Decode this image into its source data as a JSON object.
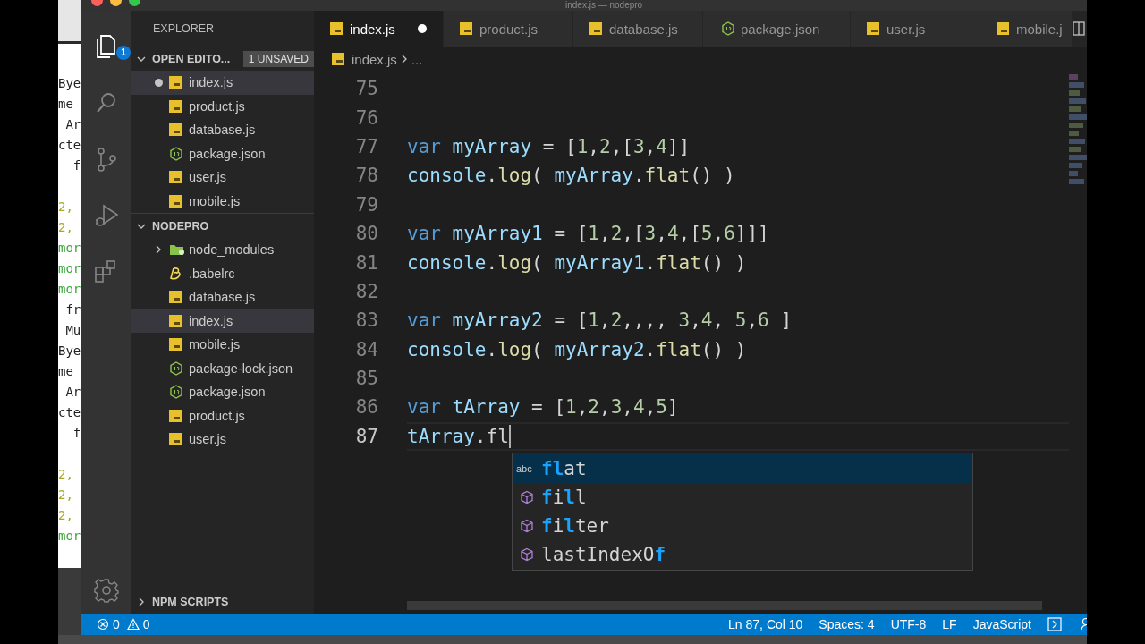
{
  "window": {
    "title": "index.js — nodepro"
  },
  "background_terminal": {
    "lines": [
      {
        "text": "Bye",
        "kind": "plain"
      },
      {
        "text": "me",
        "kind": "plain"
      },
      {
        "text": " Ar",
        "kind": "plain"
      },
      {
        "text": "cte",
        "kind": "plain"
      },
      {
        "text": "  f",
        "kind": "plain"
      },
      {
        "kind": "blank"
      },
      {
        "text": "2,",
        "kind": "number"
      },
      {
        "text": "2,",
        "kind": "number"
      },
      {
        "text": "mor",
        "kind": "string"
      },
      {
        "text": "mor",
        "kind": "string"
      },
      {
        "text": "mor",
        "kind": "string"
      },
      {
        "text": " fr",
        "kind": "plain"
      },
      {
        "text": " Mu",
        "kind": "plain"
      },
      {
        "text": "Bye",
        "kind": "plain"
      },
      {
        "text": "me",
        "kind": "plain"
      },
      {
        "text": " Ar",
        "kind": "plain"
      },
      {
        "text": "cte",
        "kind": "plain"
      },
      {
        "text": "  f",
        "kind": "plain"
      },
      {
        "kind": "blank"
      },
      {
        "text": "2,",
        "kind": "number"
      },
      {
        "text": "2,",
        "kind": "number"
      },
      {
        "text": "2,",
        "kind": "number"
      },
      {
        "text": "mor",
        "kind": "string"
      }
    ]
  },
  "activity_bar": {
    "items": [
      {
        "kind": "explorer",
        "selected": true,
        "badge": "1"
      },
      {
        "kind": "search",
        "selected": false
      },
      {
        "kind": "source-control",
        "selected": false
      },
      {
        "kind": "debug",
        "selected": false
      },
      {
        "kind": "extensions",
        "selected": false
      }
    ],
    "bottom": [
      {
        "kind": "settings"
      }
    ]
  },
  "sidebar": {
    "title": "EXPLORER",
    "sections": [
      {
        "title": "OPEN EDITO...",
        "expanded": true,
        "badge": "1 UNSAVED",
        "items": [
          {
            "label": "index.js",
            "kind": "js",
            "dirty": true,
            "selected": true
          },
          {
            "label": "product.js",
            "kind": "js",
            "dirty": false,
            "selected": false
          },
          {
            "label": "database.js",
            "kind": "js",
            "dirty": false,
            "selected": false
          },
          {
            "label": "package.json",
            "kind": "node",
            "dirty": false,
            "selected": false
          },
          {
            "label": "user.js",
            "kind": "js",
            "dirty": false,
            "selected": false
          },
          {
            "label": "mobile.js",
            "kind": "js",
            "dirty": false,
            "selected": false
          }
        ]
      },
      {
        "title": "NODEPRO",
        "expanded": true,
        "items": [
          {
            "label": "node_modules",
            "kind": "folder",
            "expanded": false,
            "selected": false
          },
          {
            "label": ".babelrc",
            "kind": "babel",
            "selected": false
          },
          {
            "label": "database.js",
            "kind": "js",
            "selected": false
          },
          {
            "label": "index.js",
            "kind": "js",
            "selected": true
          },
          {
            "label": "mobile.js",
            "kind": "js",
            "selected": false
          },
          {
            "label": "package-lock.json",
            "kind": "node",
            "selected": false
          },
          {
            "label": "package.json",
            "kind": "node",
            "selected": false
          },
          {
            "label": "product.js",
            "kind": "js",
            "selected": false
          },
          {
            "label": "user.js",
            "kind": "js",
            "selected": false
          }
        ]
      },
      {
        "title": "NPM SCRIPTS",
        "expanded": false
      }
    ]
  },
  "tabs": [
    {
      "label": "index.js",
      "kind": "js",
      "selected": true,
      "dirty": true
    },
    {
      "label": "product.js",
      "kind": "js",
      "selected": false,
      "dirty": false
    },
    {
      "label": "database.js",
      "kind": "js",
      "selected": false,
      "dirty": false
    },
    {
      "label": "package.json",
      "kind": "node",
      "selected": false,
      "dirty": false
    },
    {
      "label": "user.js",
      "kind": "js",
      "selected": false,
      "dirty": false
    },
    {
      "label": "mobile.j",
      "kind": "js",
      "selected": false,
      "dirty": false
    }
  ],
  "breadcrumbs": [
    {
      "label": "index.js",
      "kind": "js"
    },
    {
      "label": "..."
    }
  ],
  "editor": {
    "lines": [
      {
        "number": "75",
        "current": false
      },
      {
        "number": "76",
        "current": false
      },
      {
        "number": "77",
        "current": false,
        "tokens": [
          {
            "text": "var",
            "kind": "keyword"
          },
          {
            "text": " myArray",
            "kind": "variable"
          },
          {
            "text": " = [",
            "kind": "plain"
          },
          {
            "text": "1",
            "kind": "number"
          },
          {
            "text": ",",
            "kind": "plain"
          },
          {
            "text": "2",
            "kind": "number"
          },
          {
            "text": ",[",
            "kind": "plain"
          },
          {
            "text": "3",
            "kind": "number"
          },
          {
            "text": ",",
            "kind": "plain"
          },
          {
            "text": "4",
            "kind": "number"
          },
          {
            "text": "]]",
            "kind": "plain"
          }
        ]
      },
      {
        "number": "78",
        "current": false,
        "tokens": [
          {
            "text": "console",
            "kind": "variable"
          },
          {
            "text": ".",
            "kind": "plain"
          },
          {
            "text": "log",
            "kind": "function"
          },
          {
            "text": "( ",
            "kind": "plain"
          },
          {
            "text": "myArray",
            "kind": "variable"
          },
          {
            "text": ".",
            "kind": "plain"
          },
          {
            "text": "flat",
            "kind": "function"
          },
          {
            "text": "() )",
            "kind": "plain"
          }
        ]
      },
      {
        "number": "79",
        "current": false
      },
      {
        "number": "80",
        "current": false,
        "tokens": [
          {
            "text": "var",
            "kind": "keyword"
          },
          {
            "text": " myArray1",
            "kind": "variable"
          },
          {
            "text": " = [",
            "kind": "plain"
          },
          {
            "text": "1",
            "kind": "number"
          },
          {
            "text": ",",
            "kind": "plain"
          },
          {
            "text": "2",
            "kind": "number"
          },
          {
            "text": ",[",
            "kind": "plain"
          },
          {
            "text": "3",
            "kind": "number"
          },
          {
            "text": ",",
            "kind": "plain"
          },
          {
            "text": "4",
            "kind": "number"
          },
          {
            "text": ",[",
            "kind": "plain"
          },
          {
            "text": "5",
            "kind": "number"
          },
          {
            "text": ",",
            "kind": "plain"
          },
          {
            "text": "6",
            "kind": "number"
          },
          {
            "text": "]]]",
            "kind": "plain"
          }
        ]
      },
      {
        "number": "81",
        "current": false,
        "tokens": [
          {
            "text": "console",
            "kind": "variable"
          },
          {
            "text": ".",
            "kind": "plain"
          },
          {
            "text": "log",
            "kind": "function"
          },
          {
            "text": "( ",
            "kind": "plain"
          },
          {
            "text": "myArray1",
            "kind": "variable"
          },
          {
            "text": ".",
            "kind": "plain"
          },
          {
            "text": "flat",
            "kind": "function"
          },
          {
            "text": "() )",
            "kind": "plain"
          }
        ]
      },
      {
        "number": "82",
        "current": false
      },
      {
        "number": "83",
        "current": false,
        "tokens": [
          {
            "text": "var",
            "kind": "keyword"
          },
          {
            "text": " myArray2",
            "kind": "variable"
          },
          {
            "text": " = [",
            "kind": "plain"
          },
          {
            "text": "1",
            "kind": "number"
          },
          {
            "text": ",",
            "kind": "plain"
          },
          {
            "text": "2",
            "kind": "number"
          },
          {
            "text": ",,,, ",
            "kind": "plain"
          },
          {
            "text": "3",
            "kind": "number"
          },
          {
            "text": ",",
            "kind": "plain"
          },
          {
            "text": "4",
            "kind": "number"
          },
          {
            "text": ", ",
            "kind": "plain"
          },
          {
            "text": "5",
            "kind": "number"
          },
          {
            "text": ",",
            "kind": "plain"
          },
          {
            "text": "6",
            "kind": "number"
          },
          {
            "text": " ]",
            "kind": "plain"
          }
        ]
      },
      {
        "number": "84",
        "current": false,
        "tokens": [
          {
            "text": "console",
            "kind": "variable"
          },
          {
            "text": ".",
            "kind": "plain"
          },
          {
            "text": "log",
            "kind": "function"
          },
          {
            "text": "( ",
            "kind": "plain"
          },
          {
            "text": "myArray2",
            "kind": "variable"
          },
          {
            "text": ".",
            "kind": "plain"
          },
          {
            "text": "flat",
            "kind": "function"
          },
          {
            "text": "() )",
            "kind": "plain"
          }
        ]
      },
      {
        "number": "85",
        "current": false
      },
      {
        "number": "86",
        "current": false,
        "tokens": [
          {
            "text": "var",
            "kind": "keyword"
          },
          {
            "text": " tArray",
            "kind": "variable"
          },
          {
            "text": " = [",
            "kind": "plain"
          },
          {
            "text": "1",
            "kind": "number"
          },
          {
            "text": ",",
            "kind": "plain"
          },
          {
            "text": "2",
            "kind": "number"
          },
          {
            "text": ",",
            "kind": "plain"
          },
          {
            "text": "3",
            "kind": "number"
          },
          {
            "text": ",",
            "kind": "plain"
          },
          {
            "text": "4",
            "kind": "number"
          },
          {
            "text": ",",
            "kind": "plain"
          },
          {
            "text": "5",
            "kind": "number"
          },
          {
            "text": "]",
            "kind": "plain"
          }
        ]
      },
      {
        "number": "87",
        "current": true,
        "tokens": [
          {
            "text": "tArray",
            "kind": "variable"
          },
          {
            "text": ".fl",
            "kind": "plain"
          }
        ]
      }
    ]
  },
  "suggestions": {
    "items": [
      {
        "kind": "text",
        "icon_label": "abc",
        "selected": true,
        "parts": [
          {
            "text": "fl",
            "match": true
          },
          {
            "text": "at",
            "match": false
          }
        ]
      },
      {
        "kind": "method",
        "selected": false,
        "parts": [
          {
            "text": "f",
            "match": true
          },
          {
            "text": "i",
            "match": false
          },
          {
            "text": "l",
            "match": true
          },
          {
            "text": "l",
            "match": false
          }
        ]
      },
      {
        "kind": "method",
        "selected": false,
        "parts": [
          {
            "text": "f",
            "match": true
          },
          {
            "text": "i",
            "match": false
          },
          {
            "text": "l",
            "match": true
          },
          {
            "text": "ter",
            "match": false
          }
        ]
      },
      {
        "kind": "method",
        "selected": false,
        "parts": [
          {
            "text": "lastIndexO",
            "match": false
          },
          {
            "text": "f",
            "match": true
          }
        ]
      }
    ]
  },
  "status_bar": {
    "errors": "0",
    "warnings": "0",
    "items": [
      "Ln 87, Col 10",
      "Spaces: 4",
      "UTF-8",
      "LF",
      "JavaScript"
    ]
  }
}
